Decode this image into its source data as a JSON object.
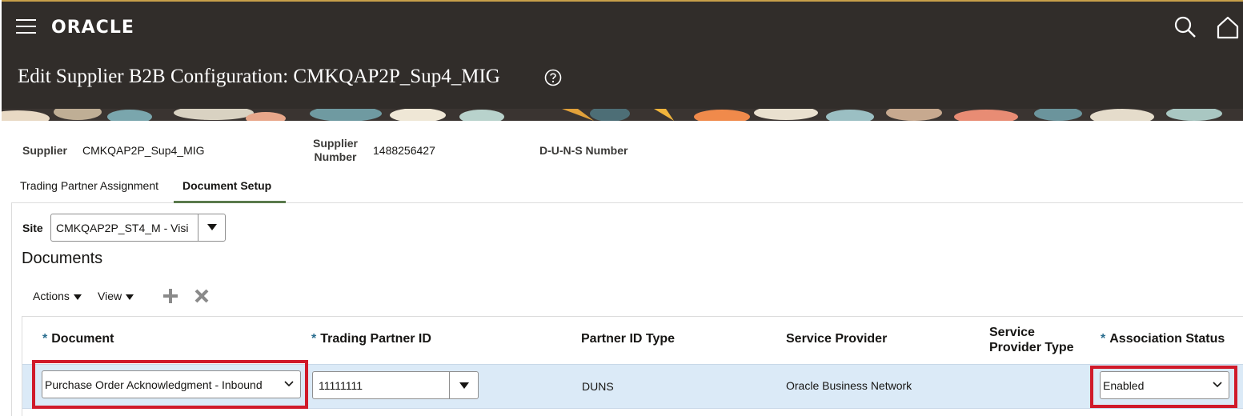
{
  "app": {
    "logo": "ORACLE",
    "page_title": "Edit Supplier B2B Configuration: CMKQAP2P_Sup4_MIG"
  },
  "supplier_info": {
    "supplier_label": "Supplier",
    "supplier_value": "CMKQAP2P_Sup4_MIG",
    "supplier_number_label_1": "Supplier",
    "supplier_number_label_2": "Number",
    "supplier_number_value": "1488256427",
    "duns_label": "D-U-N-S Number"
  },
  "tabs": [
    {
      "label": "Trading Partner Assignment",
      "active": false
    },
    {
      "label": "Document Setup",
      "active": true
    }
  ],
  "site": {
    "label": "Site",
    "value": "CMKQAP2P_ST4_M - Visi"
  },
  "documents": {
    "title": "Documents",
    "toolbar": {
      "actions_label": "Actions",
      "view_label": "View"
    },
    "columns": {
      "document": "Document",
      "trading_partner_id": "Trading Partner ID",
      "partner_id_type": "Partner ID Type",
      "service_provider": "Service Provider",
      "service_provider_type_1": "Service",
      "service_provider_type_2": "Provider Type",
      "association_status": "Association Status"
    },
    "rows": [
      {
        "document": "Purchase Order Acknowledgment - Inbound",
        "trading_partner_id": "11111111",
        "partner_id_type": "DUNS",
        "service_provider": "Oracle Business Network",
        "service_provider_type": "",
        "association_status": "Enabled"
      }
    ]
  },
  "colors": {
    "header_bg": "#312d2a",
    "required_marker": "#2b6e8f",
    "selected_row": "#dbeaf7",
    "highlight": "#d01a2a",
    "active_tab": "#5a7a4c"
  }
}
